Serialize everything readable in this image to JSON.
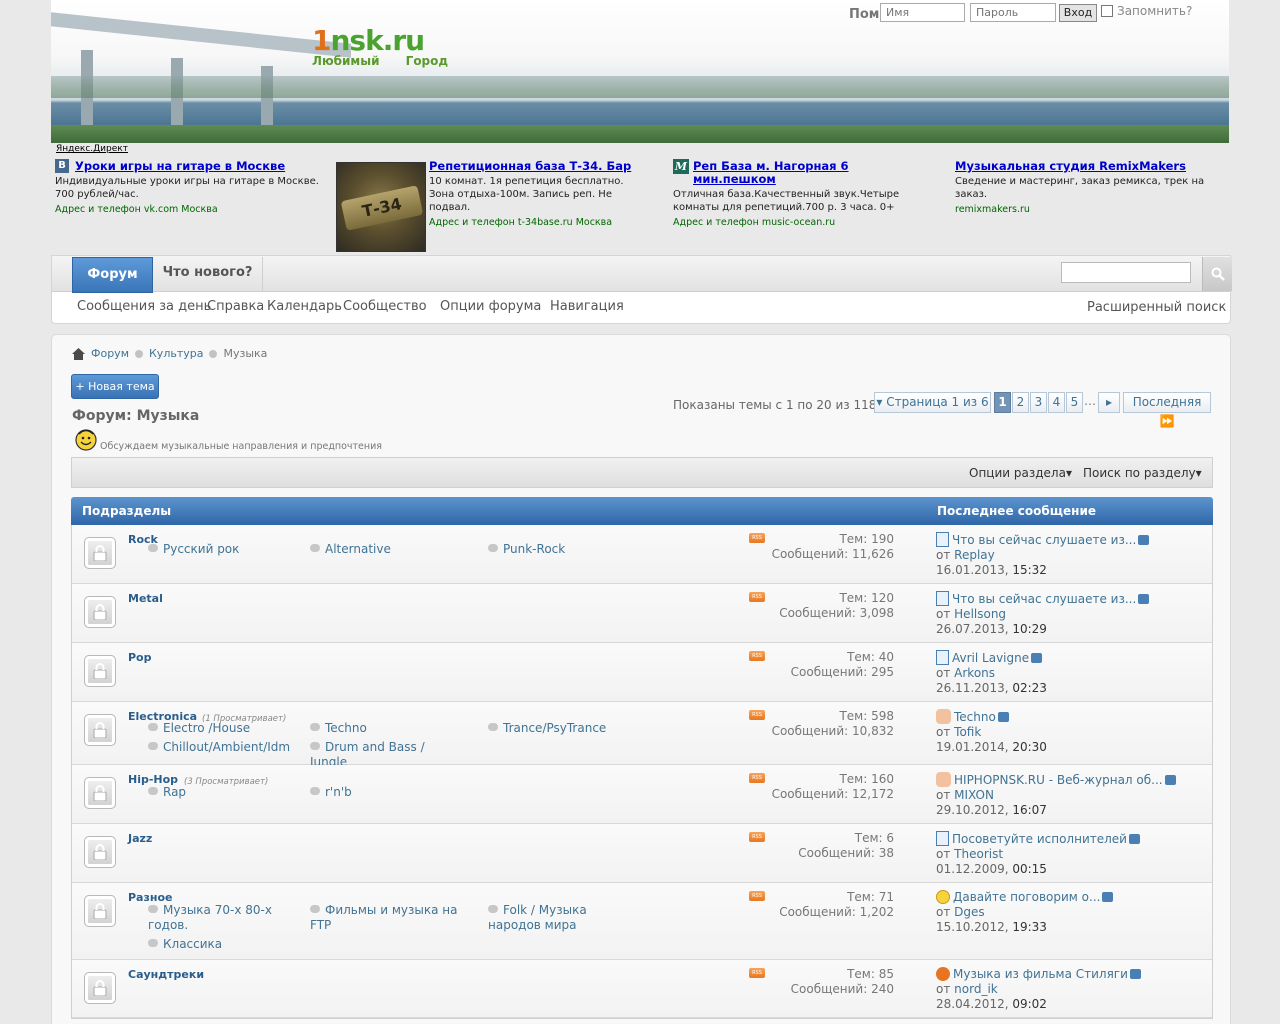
{
  "header": {
    "logo_main_one": "1",
    "logo_main_rest": "nsk.ru",
    "logo_sub": "Любимый Город",
    "help": "Помощь",
    "username_placeholder": "Имя",
    "password_placeholder": "Пароль",
    "login_button": "Вход",
    "remember": "Запомнить?"
  },
  "ads": {
    "yandex": "Яндекс.Директ",
    "items": [
      {
        "title": "Уроки игры на гитаре в Москве",
        "text": "Индивидуальные уроки игры на гитаре в Москве. 700 рублей/час.",
        "url": "Адрес и телефон  vk.com Москва"
      },
      {
        "title": "Репетиционная база Т-34. Бар",
        "text": "10 комнат. 1я репетиция бесплатно. Зона отдыха-100м. Запись реп. Не подвал.",
        "url": "Адрес и телефон  t-34base.ru Москва",
        "image_text": "Т-34"
      },
      {
        "title": "Реп База м. Нагорная 6 мин.пешком",
        "text": "Отличная база.Качественный звук.Четыре комнаты для репетиций.700 р. 3 часа. 0+",
        "url": "Адрес и телефон  music-ocean.ru"
      },
      {
        "title": "Музыкальная студия RemixMakers",
        "text": "Сведение и мастеринг, заказ ремикса, трек на заказ.",
        "url": "remixmakers.ru"
      }
    ]
  },
  "navbar": {
    "tab_forum": "Форум",
    "tab_new": "Что нового?",
    "subnav": [
      "Сообщения за день",
      "Справка",
      "Календарь",
      "Сообщество",
      "Опции форума",
      "Навигация"
    ],
    "advanced_search": "Расширенный поиск"
  },
  "breadcrumb": [
    "Форум",
    "Культура",
    "Музыка"
  ],
  "new_topic": "+ Новая тема",
  "forum": {
    "title": "Форум: Музыка",
    "description": "Обсуждаем музыкальные направления и предпочтения",
    "threads_shown": "Показаны темы с 1 по 20 из 118"
  },
  "pagination": {
    "page_of": "Страница 1 из 6",
    "pages": [
      "1",
      "2",
      "3",
      "4",
      "5"
    ],
    "dots": "…",
    "last": "Последняя"
  },
  "options": {
    "section_options": "Опции раздела",
    "section_search": "Поиск по разделу"
  },
  "table": {
    "head_left": "Подразделы",
    "head_right": "Последнее сообщение",
    "rows": [
      {
        "name": "Rock",
        "viewers": "",
        "subs": [
          "Русский рок",
          "Alternative",
          "Punk-Rock"
        ],
        "threads": "Тем: 190",
        "posts": "Сообщений: 11,626",
        "last_title": "Что вы сейчас слушаете из...",
        "by": "от ",
        "user": "Replay",
        "date": "16.01.2013, ",
        "time": "15:32",
        "icon": "doc"
      },
      {
        "name": "Metal",
        "viewers": "",
        "subs": [],
        "threads": "Тем: 120",
        "posts": "Сообщений: 3,098",
        "last_title": "Что вы сейчас слушаете из...",
        "by": "от ",
        "user": "Hellsong",
        "date": "26.07.2013, ",
        "time": "10:29",
        "icon": "doc"
      },
      {
        "name": "Pop",
        "viewers": "",
        "subs": [],
        "threads": "Тем: 40",
        "posts": "Сообщений: 295",
        "last_title": "Avril Lavigne",
        "by": "от ",
        "user": "Arkons",
        "date": "26.11.2013, ",
        "time": "02:23",
        "icon": "doc"
      },
      {
        "name": "Electronica",
        "viewers": "(1 Просматривает)",
        "subs": [
          "Electro /House",
          "Techno",
          "Trance/PsyTrance",
          "Chillout/Ambient/Idm",
          "Drum and Bass / Jungle"
        ],
        "threads": "Тем: 598",
        "posts": "Сообщений: 10,832",
        "last_title": "Techno",
        "by": "от ",
        "user": "Tofik",
        "date": "19.01.2014, ",
        "time": "20:30",
        "icon": "hand"
      },
      {
        "name": "Hip-Hop",
        "viewers": "(3 Просматривает)",
        "subs": [
          "Rap",
          "r'n'b"
        ],
        "threads": "Тем: 160",
        "posts": "Сообщений: 12,172",
        "last_title": "HIPHOPNSK.RU - Веб-журнал об...",
        "by": "от ",
        "user": "MIXON",
        "date": "29.10.2012, ",
        "time": "16:07",
        "icon": "hand"
      },
      {
        "name": "Jazz",
        "viewers": "",
        "subs": [],
        "threads": "Тем: 6",
        "posts": "Сообщений: 38",
        "last_title": "Посоветуйте исполнителей",
        "by": "от ",
        "user": "Theorist",
        "date": "01.12.2009, ",
        "time": "00:15",
        "icon": "doc"
      },
      {
        "name": "Разное",
        "viewers": "",
        "subs": [
          "Музыка 70-х 80-х годов.",
          "Фильмы и музыка на FTP",
          "Folk / Музыка народов мира",
          "Классика"
        ],
        "threads": "Тем: 71",
        "posts": "Сообщений: 1,202",
        "last_title": "Давайте поговорим о...",
        "by": "от ",
        "user": "Dges",
        "date": "15.10.2012, ",
        "time": "19:33",
        "icon": "smile"
      },
      {
        "name": "Саундтреки",
        "viewers": "",
        "subs": [],
        "threads": "Тем: 85",
        "posts": "Сообщений: 240",
        "last_title": "Музыка из фильма Стиляги",
        "by": "от ",
        "user": "nord_ik",
        "date": "28.04.2012, ",
        "time": "09:02",
        "icon": "warn"
      }
    ]
  }
}
